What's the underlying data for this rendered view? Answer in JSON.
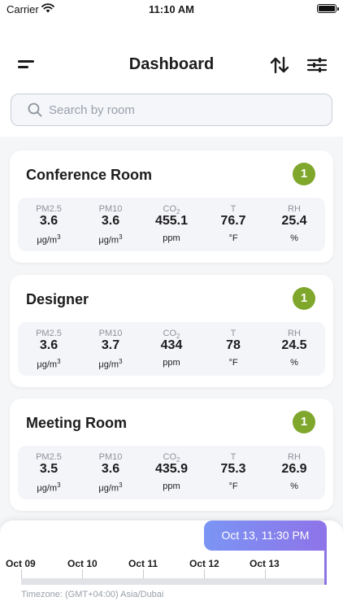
{
  "status_bar": {
    "carrier": "Carrier",
    "time": "11:10 AM"
  },
  "header": {
    "title": "Dashboard"
  },
  "search": {
    "placeholder": "Search by room"
  },
  "metric_labels": {
    "pm25": "PM2.5",
    "pm10": "PM10",
    "co2_base": "CO",
    "co2_sub": "2",
    "t": "T",
    "rh": "RH"
  },
  "metric_units": {
    "ug_base": "μg/m",
    "ug_sup": "3",
    "ppm": "ppm",
    "f": "°F",
    "pct": "%"
  },
  "rooms": [
    {
      "name": "Conference Room",
      "badge": "1",
      "pm25": "3.6",
      "pm10": "3.6",
      "co2": "455.1",
      "t": "76.7",
      "rh": "25.4"
    },
    {
      "name": "Designer",
      "badge": "1",
      "pm25": "3.6",
      "pm10": "3.7",
      "co2": "434",
      "t": "78",
      "rh": "24.5"
    },
    {
      "name": "Meeting Room",
      "badge": "1",
      "pm25": "3.5",
      "pm10": "3.6",
      "co2": "435.9",
      "t": "75.3",
      "rh": "26.9"
    }
  ],
  "colors": {
    "badge": "#7ea72b",
    "accent_start": "#7b95f4",
    "accent_end": "#8e73e8"
  },
  "timeline": {
    "selected": "Oct 13, 11:30 PM",
    "ticks": [
      "Oct 09",
      "Oct 10",
      "Oct 11",
      "Oct 12",
      "Oct 13"
    ],
    "timezone": "Timezone: (GMT+04:00) Asia/Dubai"
  }
}
